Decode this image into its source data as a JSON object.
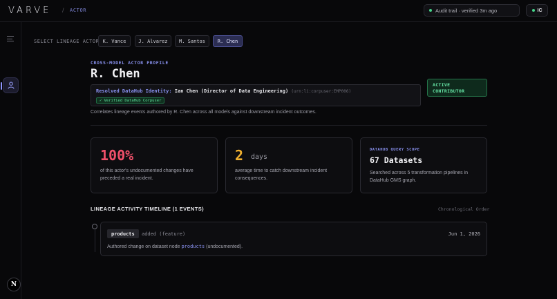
{
  "header": {
    "logo": "VARVE",
    "separator": "/",
    "breadcrumb": "ACTOR",
    "audit_status": "Audit trail · verified 3m ago",
    "user_initials": "IC"
  },
  "selector": {
    "label": "SELECT LINEAGE ACTOR:",
    "actors": [
      "K. Vance",
      "J. Alvarez",
      "M. Santos",
      "R. Chen"
    ],
    "selected": "R. Chen"
  },
  "profile": {
    "eyebrow": "CROSS-MODEL ACTOR PROFILE",
    "name": "R. Chen",
    "identity_label": "Resolved DataHub Identity:",
    "identity_value": "Ian Chen (Director of Data Engineering)",
    "identity_urn": "(urn:li:corpuser:EMP006)",
    "verified_label": "✓ Verified DataHub Corpuser",
    "status_badge_line1": "ACTIVE",
    "status_badge_line2": "CONTRIBUTOR",
    "description": "Correlates lineage events authored by R. Chen across all models against downstream incident outcomes."
  },
  "cards": {
    "undocumented": {
      "value": "100%",
      "text": "of this actor's undocumented changes have preceded a real incident."
    },
    "catch_time": {
      "value": "2",
      "unit": "days",
      "text": "average time to catch downstream incident consequences."
    },
    "scope": {
      "label": "DATAHUB QUERY SCOPE",
      "value": "67 Datasets",
      "text": "Searched across 5 transformation pipelines in DataHub GMS graph."
    }
  },
  "timeline": {
    "title": "LINEAGE ACTIVITY TIMELINE (1 EVENTS)",
    "order": "Chronological Order",
    "events": [
      {
        "dataset": "products",
        "type": "added (feature)",
        "date": "Jun 1, 2026",
        "desc_prefix": "Authored change on dataset node",
        "desc_link": "products",
        "desc_suffix": "(undocumented)."
      }
    ]
  },
  "sidebar": {
    "icons": [
      "menu-icon",
      "user-icon"
    ],
    "badge": "N"
  },
  "colors": {
    "accent": "#8a92f0",
    "success": "#5fe3a0",
    "danger": "#f0506a",
    "warning": "#f0b030",
    "background": "#08080a"
  }
}
